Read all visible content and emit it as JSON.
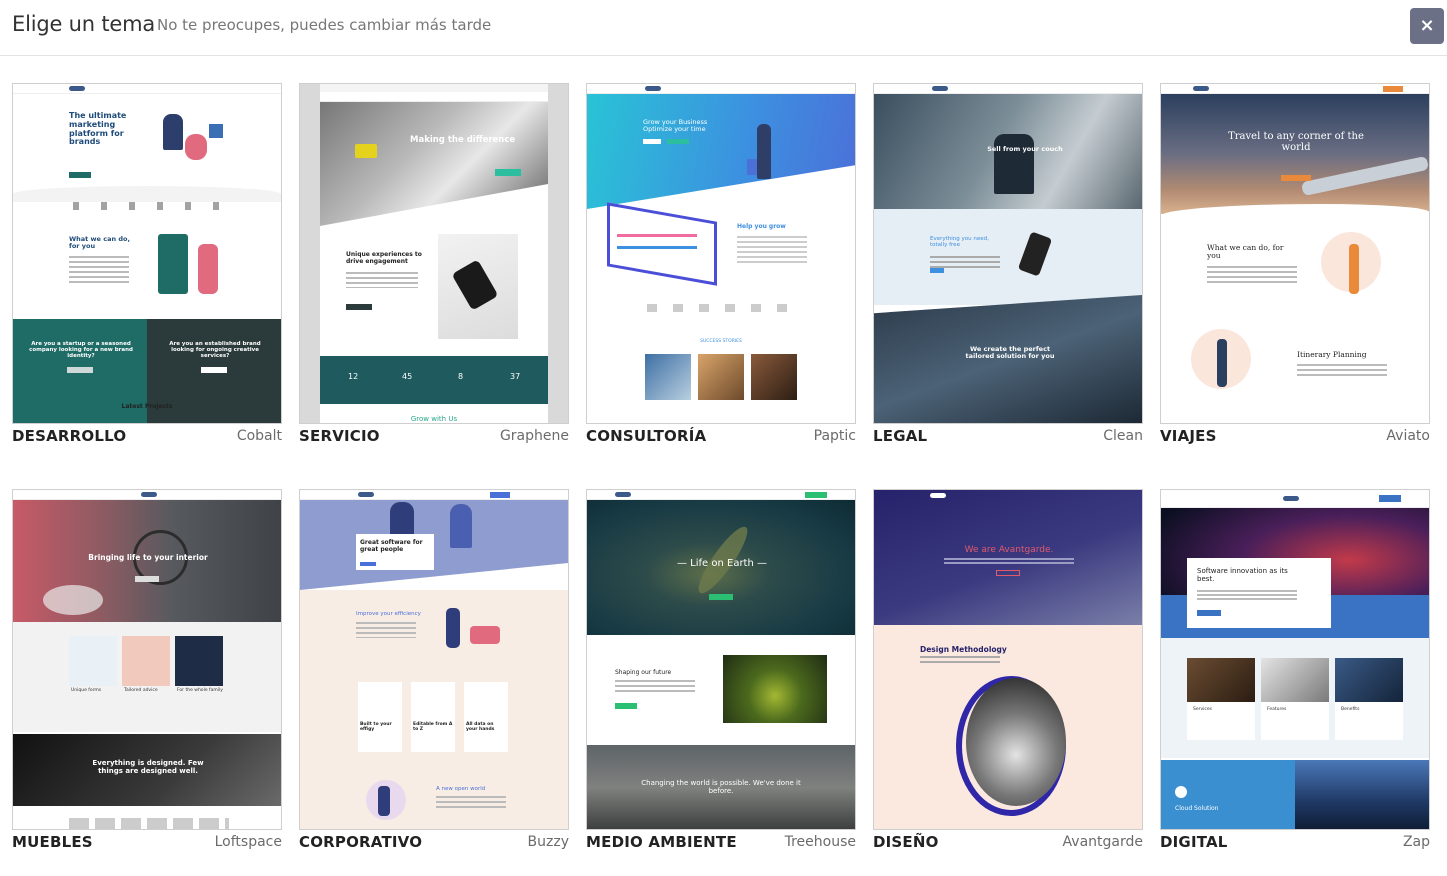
{
  "header": {
    "title": "Elige un tema",
    "subtitle": "No te preocupes, puedes cambiar más tarde",
    "close_label": "×"
  },
  "themes": [
    {
      "category": "DESARROLLO",
      "name": "Cobalt",
      "preview": {
        "hero": "The ultimate marketing platform for brands",
        "section": "What we can do, for you",
        "cta_left": "Are you a startup or a seasoned company looking for a new brand identity?",
        "cta_right": "Are you an established brand looking for ongoing creative services?",
        "footer": "Latest Projects"
      }
    },
    {
      "category": "SERVICIO",
      "name": "Graphene",
      "preview": {
        "hero": "Making the difference",
        "section": "Unique experiences to drive engagement",
        "stats": [
          "12",
          "45",
          "8",
          "37"
        ],
        "footer": "Grow with Us"
      }
    },
    {
      "category": "CONSULTORÍA",
      "name": "Paptic",
      "preview": {
        "hero": "Grow your Business Optimize your time",
        "section": "Help you grow",
        "stories": "SUCCESS STORIES"
      }
    },
    {
      "category": "LEGAL",
      "name": "Clean",
      "preview": {
        "hero": "Sell from your couch",
        "section": "Everything you need, totally free",
        "banner": "We create the perfect tailored solution for you"
      }
    },
    {
      "category": "VIAJES",
      "name": "Aviato",
      "preview": {
        "hero": "Travel to any corner of the world",
        "section": "What we can do, for you",
        "feature": "Itinerary Planning"
      }
    },
    {
      "category": "MUEBLES",
      "name": "Loftspace",
      "preview": {
        "hero": "Bringing life to your interior",
        "items": [
          "Unique forms",
          "Tailored advice",
          "For the whole family"
        ],
        "banner": "Everything is designed. Few things are designed well."
      }
    },
    {
      "category": "CORPORATIVO",
      "name": "Buzzy",
      "preview": {
        "hero": "Great software for great people",
        "section": "Improve your efficiency",
        "items": [
          "Built to your effigy",
          "Editable from A to Z",
          "All data on your hands"
        ],
        "feature": "A new open world"
      }
    },
    {
      "category": "MEDIO AMBIENTE",
      "name": "Treehouse",
      "preview": {
        "hero": "— Life on Earth —",
        "section": "Shaping our future",
        "banner": "Changing the world is possible. We've done it before."
      }
    },
    {
      "category": "DISEÑO",
      "name": "Avantgarde",
      "preview": {
        "hero": "We are Avantgarde.",
        "section": "Design Methodology"
      }
    },
    {
      "category": "DIGITAL",
      "name": "Zap",
      "preview": {
        "hero": "Software innovation as its best.",
        "items": [
          "Services",
          "Features",
          "Benefits"
        ],
        "feature": "Cloud Solution"
      }
    }
  ],
  "colors": {
    "close_bg": "#6c7086",
    "cobalt_teal": "#1f6b66",
    "graphene_teal": "#1e5a5e",
    "paptic_blue": "#3d8fe0",
    "avantgarde_navy": "#26226b",
    "zap_blue": "#3a72c4"
  }
}
